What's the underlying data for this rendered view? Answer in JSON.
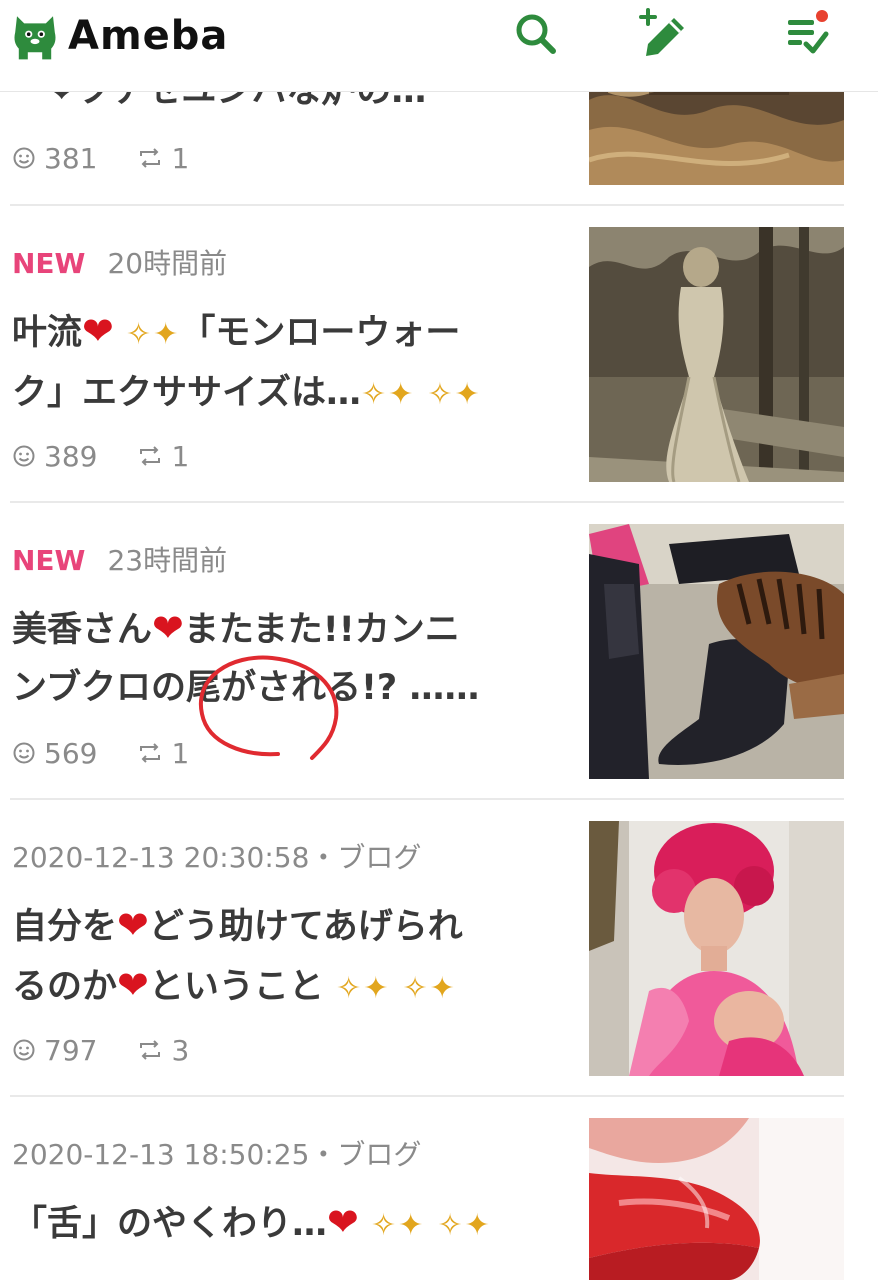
{
  "app": {
    "brand": "Ameba",
    "accent": "#2e8b3d",
    "badge_color": "#e8447a",
    "heart_color": "#d9141f",
    "sparkle_color": "#e2a61e"
  },
  "header": {
    "search_icon": "search-icon",
    "write_icon": "write-icon",
    "feed_icon": "feed-checklist-icon",
    "notification_dot": true
  },
  "posts": [
    {
      "title_line1": "ー❤ツナセユンハな炉の…",
      "likes": "381",
      "reblogs": "1",
      "thumb": "brown-satin"
    },
    {
      "is_new": true,
      "new_label": "NEW",
      "time": "20時間前",
      "title_a": "叶流",
      "title_b": "「モンローウォー",
      "title_line2": "ク」エクササイズは…",
      "likes": "389",
      "reblogs": "1",
      "thumb": "sepia-gown"
    },
    {
      "is_new": true,
      "new_label": "NEW",
      "time": "23時間前",
      "title_a": "美香さん",
      "title_b": "またまた!!カンニ",
      "title_line2": "ンブクロの尾がされる!? ……",
      "likes": "569",
      "reblogs": "1",
      "thumb": "boots-cat"
    },
    {
      "date": "2020-12-13 20:30:58",
      "category": "ブログ",
      "title_a": "自分を",
      "title_b": "どう助けてあげられ",
      "title_line2_a": "るのか",
      "title_line2_b": "ということ",
      "likes": "797",
      "reblogs": "3",
      "thumb": "pink-portrait"
    },
    {
      "date": "2020-12-13 18:50:25",
      "category": "ブログ",
      "title_a": "「舌」のやくわり…",
      "thumb": "red-lips"
    }
  ],
  "symbols": {
    "heart": "❤",
    "sparkle": "✧✦",
    "separator": "・"
  }
}
